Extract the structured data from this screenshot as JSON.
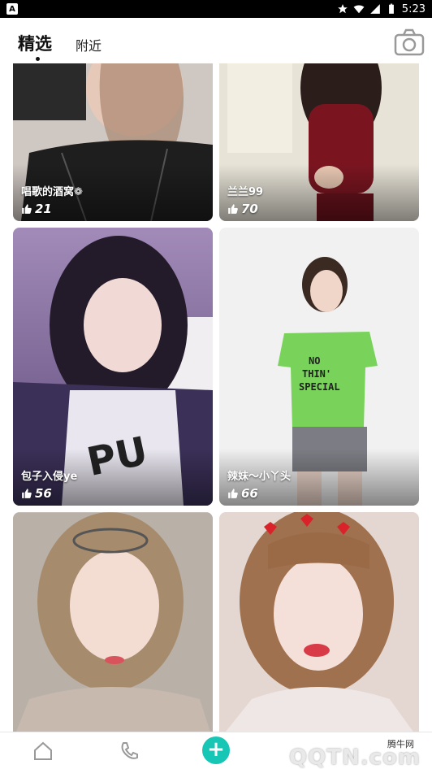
{
  "status_bar": {
    "left_badge": "A",
    "time": "5:23",
    "icons": [
      "star-icon",
      "wifi-icon",
      "signal-icon",
      "battery-icon"
    ]
  },
  "tabs": {
    "selected": "精选",
    "other": "附近"
  },
  "camera_icon": "camera-icon",
  "feed": [
    {
      "name": "唱歌的酒窝❁",
      "likes": "21"
    },
    {
      "name": "兰兰99",
      "likes": "70"
    },
    {
      "name": "包子入侵ye",
      "likes": "56"
    },
    {
      "name": "辣妹～小丫头",
      "likes": "66"
    },
    {
      "name": "",
      "likes": ""
    },
    {
      "name": "",
      "likes": ""
    }
  ],
  "bottom_nav": {
    "items": [
      "home-icon",
      "phone-icon",
      "plus-icon"
    ],
    "plus_label": "+"
  },
  "watermark": {
    "site": "腾牛网",
    "logo": "QQTN.com"
  },
  "colors": {
    "accent": "#17c6b4",
    "status_bar": "#000000"
  }
}
